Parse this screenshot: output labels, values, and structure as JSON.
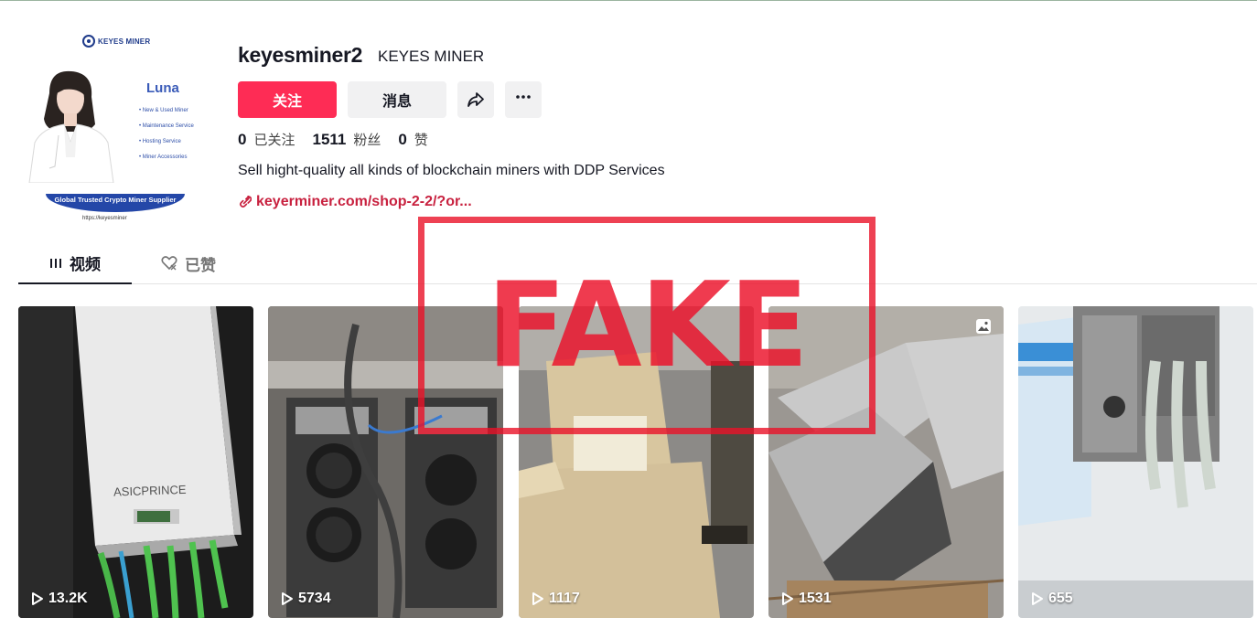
{
  "profile": {
    "username": "keyesminer2",
    "nickname": "KEYES MINER",
    "bio": "Sell hight-quality all kinds of blockchain miners with DDP Services",
    "link": "keyerminer.com/shop-2-2/?or..."
  },
  "avatar": {
    "logo": "KEYES MINER",
    "name": "Luna",
    "services": [
      "• New & Used Miner",
      "• Maintenance Service",
      "• Hosting Service",
      "• Miner Accessories"
    ],
    "banner": "Global Trusted Crypto Miner Supplier",
    "url": "https://keyesminer"
  },
  "actions": {
    "follow": "关注",
    "message": "消息"
  },
  "stats": [
    {
      "value": "0",
      "label": "已关注"
    },
    {
      "value": "1511",
      "label": "粉丝"
    },
    {
      "value": "0",
      "label": "赞"
    }
  ],
  "tabs": [
    {
      "label": "视频"
    },
    {
      "label": "已赞"
    }
  ],
  "videos": [
    {
      "views": "13.2K",
      "brand": "ASICPRINCE"
    },
    {
      "views": "5734"
    },
    {
      "views": "1117"
    },
    {
      "views": "1531"
    },
    {
      "views": "655"
    }
  ],
  "stamp": {
    "text": "FAKE"
  },
  "colors": {
    "accent": "#fe2c55",
    "link": "#c8213f",
    "stamp": "#ea1228"
  }
}
